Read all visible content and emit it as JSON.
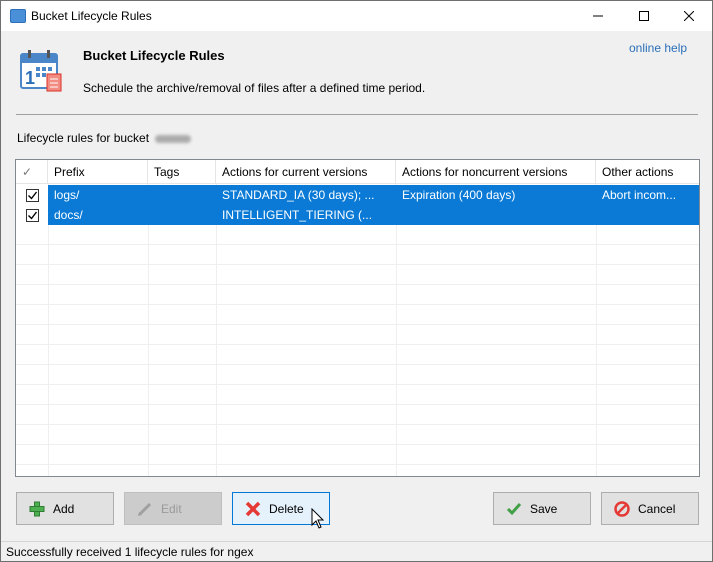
{
  "window": {
    "title": "Bucket Lifecycle Rules"
  },
  "header": {
    "title": "Bucket Lifecycle Rules",
    "subtitle": "Schedule the archive/removal of files after a defined time period.",
    "help_link": "online help"
  },
  "rules_label": "Lifecycle rules for bucket",
  "table": {
    "columns": [
      "✓",
      "Prefix",
      "Tags",
      "Actions for current versions",
      "Actions for noncurrent versions",
      "Other actions"
    ],
    "rows": [
      {
        "checked": true,
        "prefix": "logs/",
        "tags": "",
        "current": "STANDARD_IA (30 days); ...",
        "noncurrent": "Expiration (400 days)",
        "other": "Abort incom..."
      },
      {
        "checked": true,
        "prefix": "docs/",
        "tags": "",
        "current": "INTELLIGENT_TIERING (...",
        "noncurrent": "",
        "other": ""
      }
    ]
  },
  "buttons": {
    "add": "Add",
    "edit": "Edit",
    "delete": "Delete",
    "save": "Save",
    "cancel": "Cancel"
  },
  "status": "Successfully received 1 lifecycle rules for ngex",
  "colors": {
    "selection": "#0a7ad6",
    "link": "#2a6fb8",
    "add_icon": "#4caf50",
    "delete_icon": "#e53935",
    "cancel_icon": "#e53935",
    "save_icon": "#43a047"
  }
}
